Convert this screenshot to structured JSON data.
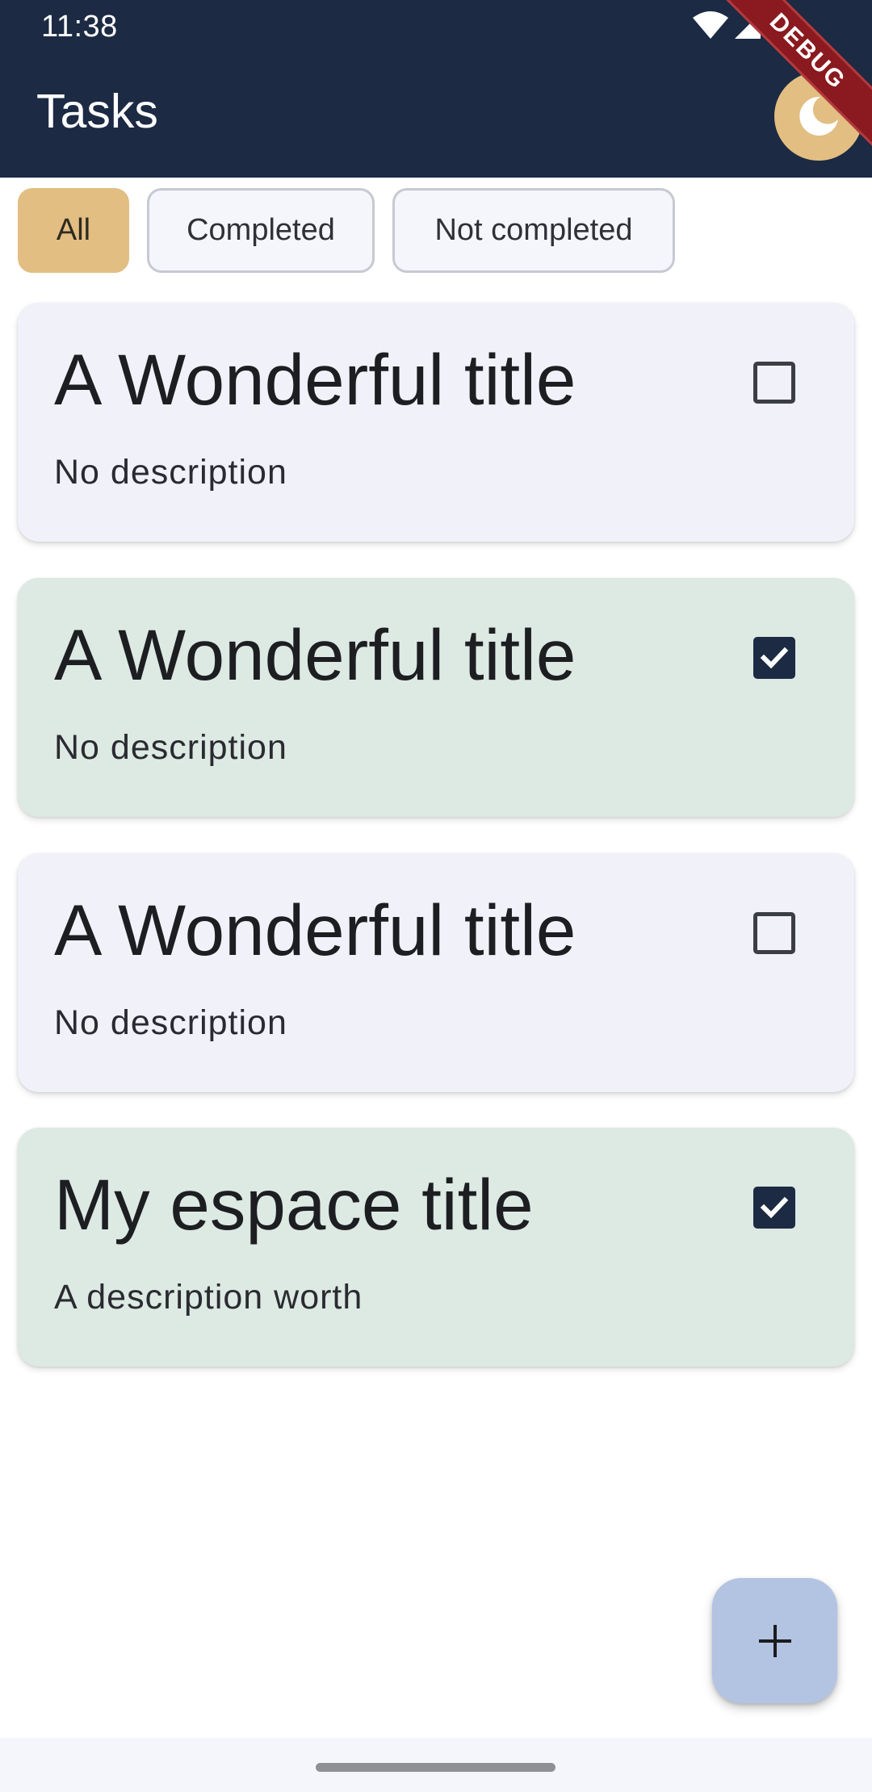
{
  "status_bar": {
    "time": "11:38",
    "icons": [
      "wifi-icon",
      "signal-icon",
      "battery-icon"
    ]
  },
  "app_bar": {
    "title": "Tasks",
    "theme_toggle_icon": "moon-icon",
    "debug_banner": "DEBUG"
  },
  "filters": [
    {
      "label": "All",
      "selected": true
    },
    {
      "label": "Completed",
      "selected": false
    },
    {
      "label": "Not completed",
      "selected": false
    }
  ],
  "tasks": [
    {
      "title": "A Wonderful title",
      "description": "No description",
      "completed": false
    },
    {
      "title": "A Wonderful title",
      "description": "No description",
      "completed": true
    },
    {
      "title": "A Wonderful title",
      "description": "No description",
      "completed": false
    },
    {
      "title": "My espace title",
      "description": "A description worth",
      "completed": true
    }
  ],
  "fab": {
    "icon": "plus-icon"
  },
  "colors": {
    "app_bar": "#1c2a43",
    "accent": "#e2be82",
    "card_default": "#f1f1fa",
    "card_completed": "#dde9e3",
    "fab": "#b3c3e2"
  }
}
